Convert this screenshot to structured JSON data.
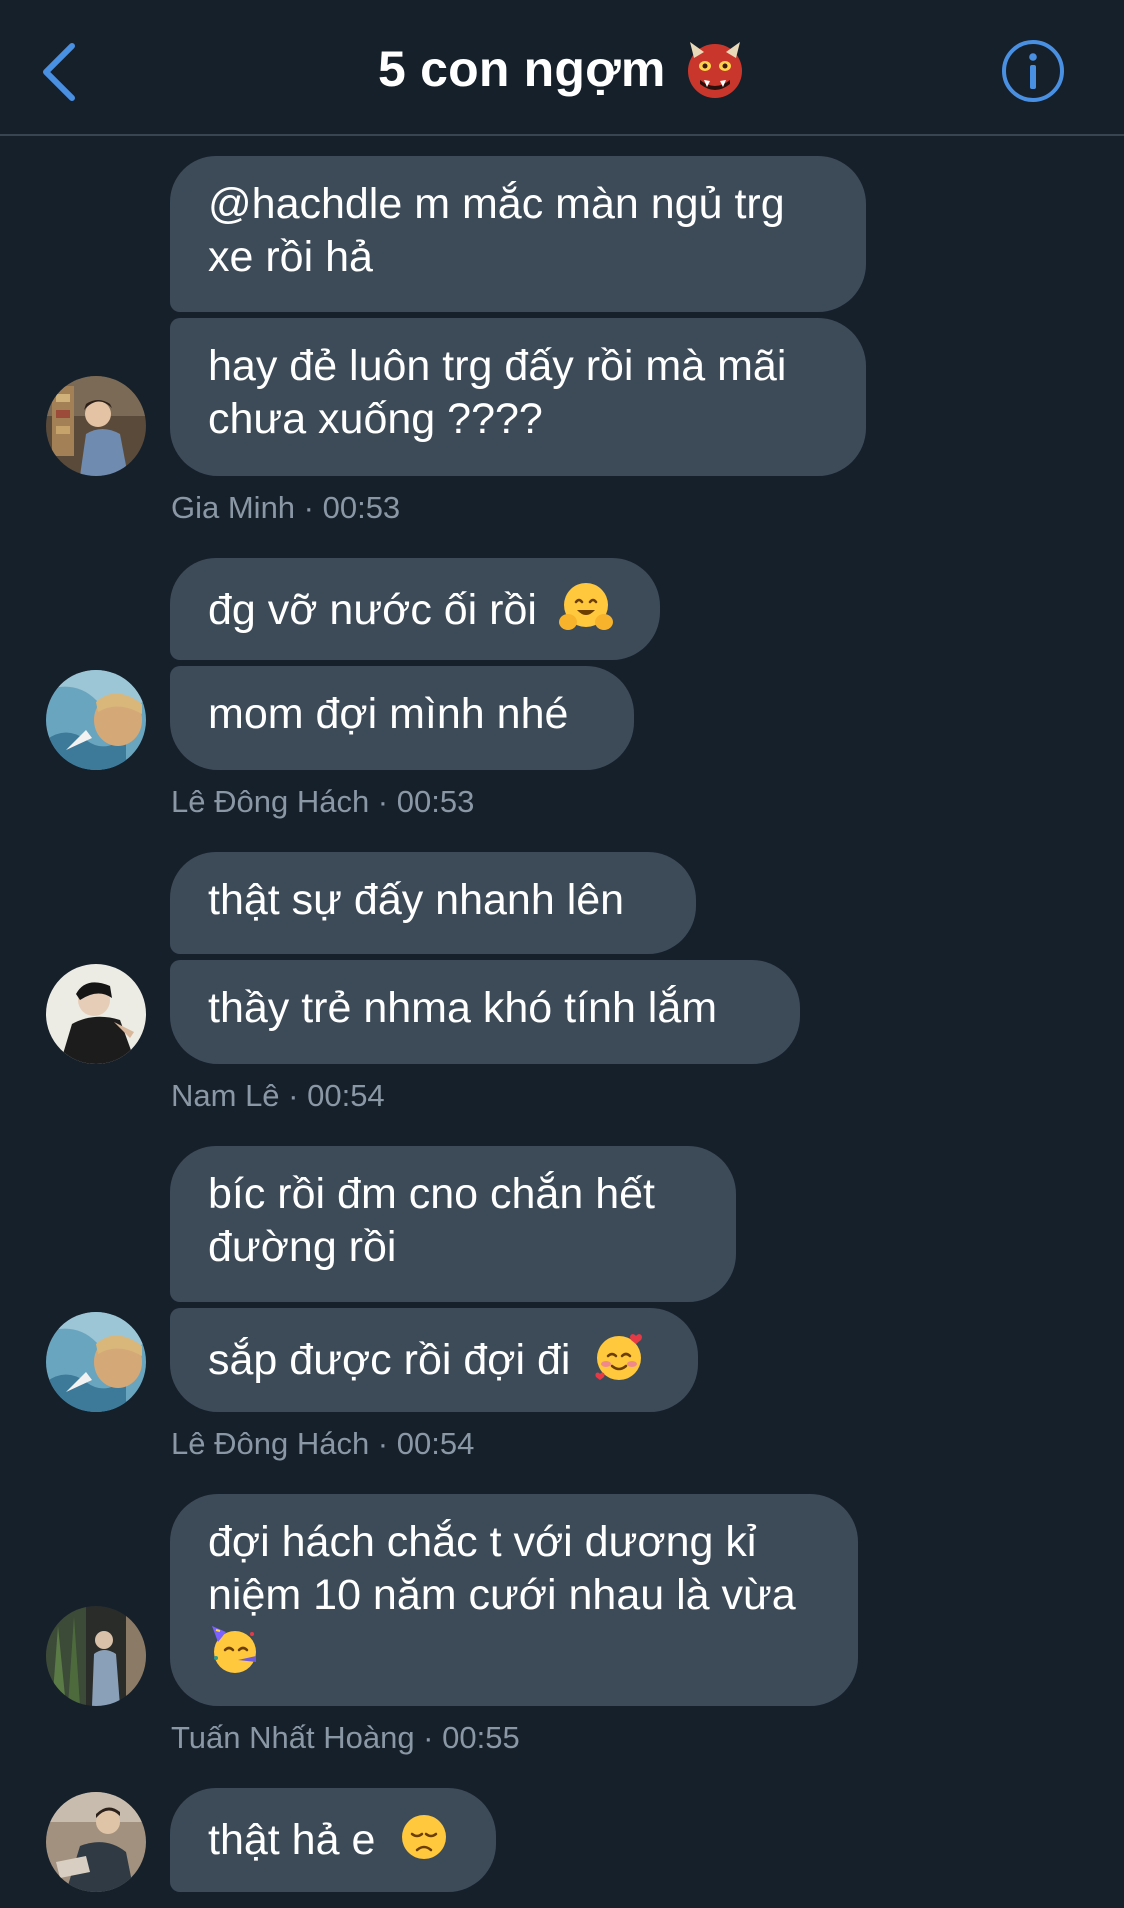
{
  "header": {
    "title": "5 con ngợm",
    "title_emoji": "ogre-emoji",
    "back_icon": "chevron-left-icon",
    "info_icon": "info-circle-icon"
  },
  "colors": {
    "background": "#16202b",
    "bubble": "#3d4b59",
    "accent": "#4a90e2",
    "meta_text": "#8a97a4"
  },
  "groups": [
    {
      "sender": "Gia Minh",
      "meta": "Gia Minh · 00:53",
      "messages": [
        {
          "line1": "@hachdle m mắc màn ngủ trg",
          "line2": "xe rồi hả"
        },
        {
          "line1": "hay đẻ luôn trg đấy rồi mà mãi",
          "line2": "chưa xuống ????"
        }
      ]
    },
    {
      "sender": "Lê Đông Hách",
      "meta": "Lê Đông Hách · 00:53",
      "messages": [
        {
          "text": "đg vỡ nước ối rồi",
          "emoji": "hugging-face-emoji"
        },
        {
          "text": "mom đợi mình nhé"
        }
      ]
    },
    {
      "sender": "Nam Lê",
      "meta": "Nam Lê · 00:54",
      "messages": [
        {
          "text": "thật sự đấy nhanh lên"
        },
        {
          "text": "thầy trẻ nhma khó tính lắm"
        }
      ]
    },
    {
      "sender": "Lê Đông Hách",
      "meta": "Lê Đông Hách · 00:54",
      "messages": [
        {
          "line1": "bíc rồi đm cno chắn hết",
          "line2": "đường rồi"
        },
        {
          "text": "sắp được rồi đợi đi",
          "emoji": "smiling-face-with-hearts-emoji"
        }
      ]
    },
    {
      "sender": "Tuấn Nhất Hoàng",
      "meta": "Tuấn Nhất Hoàng · 00:55",
      "messages": [
        {
          "line1": "đợi hách chắc t với dương kỉ",
          "line2": "niệm 10 năm cưới nhau là vừa",
          "emoji": "partying-face-emoji"
        }
      ]
    },
    {
      "sender": "",
      "messages": [
        {
          "text": "thật hả e",
          "emoji": "disappointed-face-emoji"
        }
      ]
    }
  ]
}
